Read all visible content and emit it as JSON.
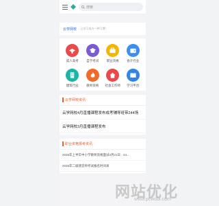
{
  "header": {
    "search_placeholder": "搜索"
  },
  "welcome": {
    "title": "云学网校",
    "subtitle": "- 让学习成为一种习惯！"
  },
  "grid": [
    {
      "label": "成人高考",
      "color": "#e94b4b",
      "icon": "hat-icon"
    },
    {
      "label": "自学考试",
      "color": "#7a5bd6",
      "icon": "graduation-cap-icon"
    },
    {
      "label": "职业资格",
      "color": "#f2b705",
      "icon": "briefcase-icon"
    },
    {
      "label": "会计行业",
      "color": "#3b8ff0",
      "icon": "wallet-icon"
    },
    {
      "label": "建筑行业",
      "color": "#19b6a4",
      "icon": "building-icon"
    },
    {
      "label": "教师资格",
      "color": "#ef6a2b",
      "icon": "flame-icon"
    },
    {
      "label": "社会工作师",
      "color": "#e84a4a",
      "icon": "house-icon"
    },
    {
      "label": "学习平台",
      "color": "#2f86e8",
      "icon": "book-icon"
    }
  ],
  "news_section": {
    "title": "云学网校资讯",
    "items": [
      "云学网校4月直播课程发布成考辅导班带244场",
      "云学网校3月直播课程发布"
    ]
  },
  "exam_section": {
    "title": "职业资格报考资讯",
    "items": [
      "2025年上半年中小学教师资格面试4月21日 - 24...",
      "2025年二级建造师考试报名时间表"
    ]
  },
  "watermark": {
    "text": "网站优化",
    "url": "www.pcwobi.com"
  }
}
